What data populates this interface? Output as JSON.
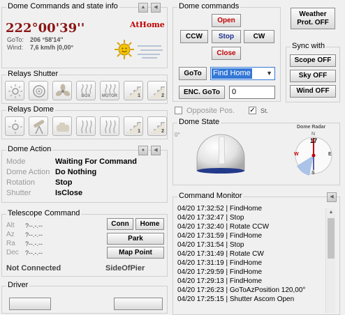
{
  "state_panel": {
    "title": "Dome Commands and state info",
    "azimuth": "222°00'39''",
    "home_status": "AtHome",
    "goto_label": "GoTo:",
    "goto_value": "206 °58'14''",
    "wind_label": "Wind:",
    "wind_value": "7,6 km/h |0,00°"
  },
  "relays_shutter": {
    "title": "Relays Shutter",
    "buttons": [
      {
        "icon": "light-icon"
      },
      {
        "icon": "target-icon"
      },
      {
        "icon": "fan-icon"
      },
      {
        "icon": "box-heat-icon",
        "label": "BOX"
      },
      {
        "icon": "motor-heat-icon",
        "label": "MOTOR"
      },
      {
        "icon": "stairs-icon",
        "label": "1"
      },
      {
        "icon": "stairs-icon",
        "label": "2"
      }
    ]
  },
  "relays_dome": {
    "title": "Relays Dome",
    "buttons": [
      {
        "icon": "light-icon"
      },
      {
        "icon": "telescope-icon"
      },
      {
        "icon": "camera-icon"
      },
      {
        "icon": "heat-icon"
      },
      {
        "icon": "motor-heat-icon"
      },
      {
        "icon": "stairs-icon",
        "label": "1"
      },
      {
        "icon": "stairs-icon",
        "label": "2"
      }
    ]
  },
  "dome_action": {
    "title": "Dome Action",
    "rows": [
      {
        "key": "Mode",
        "value": "Waiting For Command"
      },
      {
        "key": "Dome Action",
        "value": "Do Nothing"
      },
      {
        "key": "Rotation",
        "value": "Stop"
      },
      {
        "key": "Shutter",
        "value": "IsClose"
      }
    ]
  },
  "telescope_command": {
    "title": "Telescope Command",
    "rows": [
      {
        "key": "Alt",
        "value": "?--.-.--"
      },
      {
        "key": "Az",
        "value": "?--.-.--"
      },
      {
        "key": "Ra",
        "value": "?--.-.--"
      },
      {
        "key": "Dec",
        "value": "?--.-.--"
      }
    ],
    "conn_label": "Conn",
    "home_label": "Home",
    "park_label": "Park",
    "map_point_label": "Map Point",
    "status": "Not Connected",
    "side_of_pier": "SideOfPier"
  },
  "driver": {
    "title": "Driver"
  },
  "dome_commands": {
    "title": "Dome commands",
    "open_label": "Open",
    "ccw_label": "CCW",
    "stop_label": "Stop",
    "cw_label": "CW",
    "close_label": "Close",
    "goto_label": "GoTo",
    "goto_selected": "Find Home",
    "enc_goto_label": "ENC. GoTo",
    "enc_value": "0",
    "opposite_pos_label": "Opposite Pos.",
    "st_label": "St."
  },
  "weather": {
    "label_line1": "Weather",
    "label_line2": "Prot. OFF"
  },
  "sync_with": {
    "title": "Sync with",
    "scope_label": "Scope OFF",
    "sky_label": "Sky OFF",
    "wind_label": "Wind OFF"
  },
  "dome_state": {
    "title": "Dome State",
    "zero_label": "0°",
    "radar_title": "Dome Radar",
    "radar_value": "17",
    "compass": {
      "n": "N",
      "e": "E",
      "s": "S",
      "w": "W"
    }
  },
  "command_monitor": {
    "title": "Command Monitor",
    "lines": [
      "04/20 17:32:52 | FindHome",
      "04/20 17:32:47 | Stop",
      "04/20 17:32:40 | Rotate CCW",
      "04/20 17:31:59 | FindHome",
      "04/20 17:31:54 | Stop",
      "04/20 17:31:49 | Rotate CW",
      "04/20 17:31:19 | FindHome",
      "04/20 17:29:59 | FindHome",
      "04/20 17:29:13 | FindHome",
      "04/20 17:26:23 | GoToAzPosition 120,00°",
      "04/20 17:25:15 | Shutter Ascom Open"
    ]
  },
  "colors": {
    "azimuth": "#8b1414",
    "status_red": "#c00000",
    "stop_blue": "#1c2f8e",
    "select_blue": "#3478d6"
  }
}
